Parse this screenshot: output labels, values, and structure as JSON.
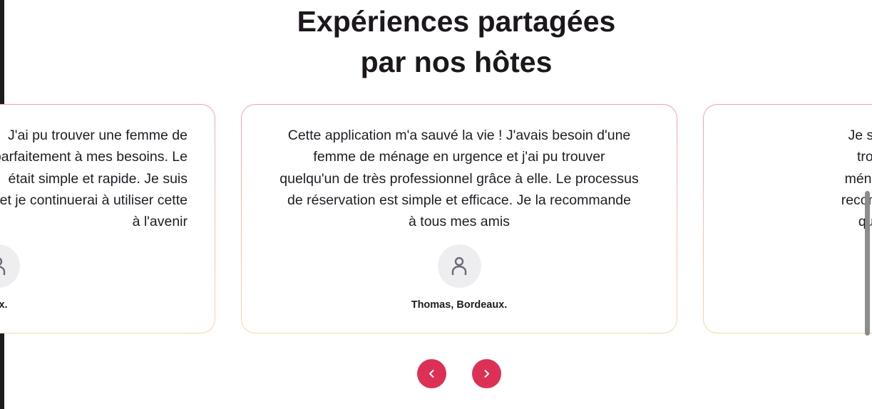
{
  "section": {
    "title_line1": "Expériences partagées",
    "title_line2": "par nos hôtes"
  },
  "testimonials": [
    {
      "quote_lines": [
        "J'ai pu trouver une femme de",
        "parfaitement à mes besoins. Le",
        "était simple et rapide. Je suis",
        "et je continuerai à utiliser cette",
        "à l'avenir"
      ],
      "author": "Thomas, Bordeaux.",
      "avatar_icon": "user-icon"
    },
    {
      "quote_lines": [
        "Cette application m'a sauvé la vie ! J'avais besoin d'une",
        "femme de ménage en urgence et j'ai pu trouver",
        "quelqu'un de très professionnel grâce à elle. Le processus",
        "de réservation est simple et efficace. Je la recommande",
        "à tous mes amis"
      ],
      "author": "Thomas, Bordeaux.",
      "avatar_icon": "user-icon"
    },
    {
      "quote_lines": [
        "Je suis très satisfait des",
        "trouvés grâce à cette",
        "ménage sont ponctuelles",
        "recommande chaudement",
        "qui ont besoin d'aide"
      ],
      "author": "",
      "avatar_icon": "user-icon"
    }
  ],
  "navigation": {
    "prev_icon": "chevron-left-icon",
    "next_icon": "chevron-right-icon"
  },
  "colors": {
    "accent": "#dc3055",
    "card_border_top": "#f3a3b1",
    "card_border_bottom": "#f6d9a7"
  }
}
